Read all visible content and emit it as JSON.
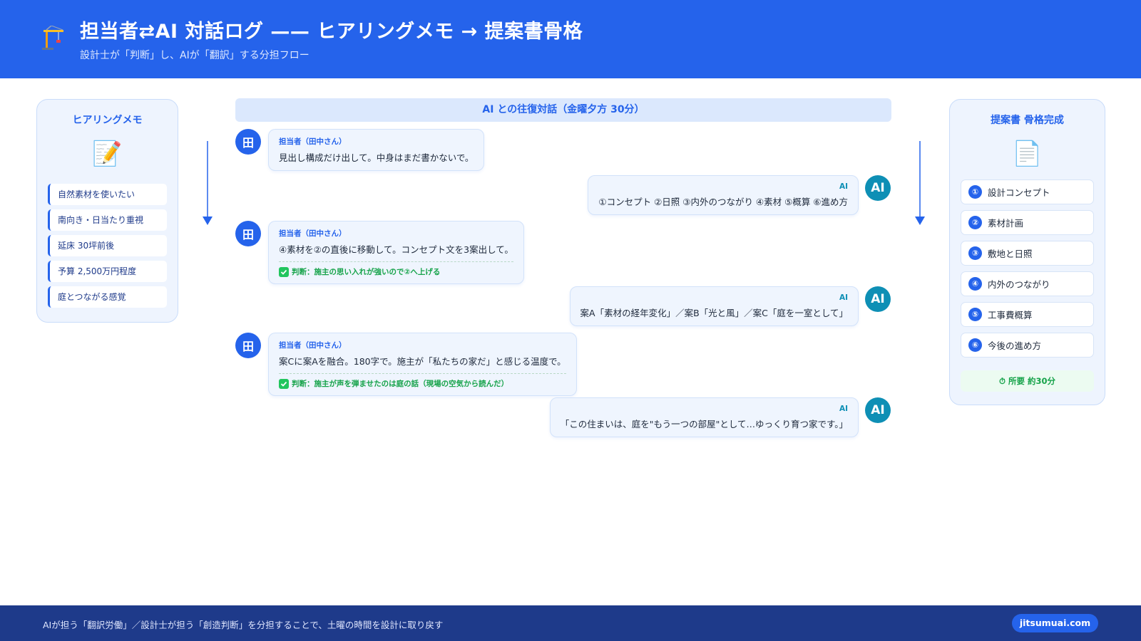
{
  "header": {
    "title": "担当者⇄AI 対話ログ —— ヒアリングメモ → 提案書骨格",
    "subtitle": "設計士が「判断」し、AIが「翻訳」する分担フロー",
    "icon": "crane-icon"
  },
  "left_panel": {
    "title": "ヒアリングメモ",
    "emoji": "📝",
    "items": [
      {
        "label": "自然素材を使いたい"
      },
      {
        "label": "南向き・日当たり重視"
      },
      {
        "label": "延床 30坪前後"
      },
      {
        "label": "予算 2,500万円程度"
      },
      {
        "label": "庭とつながる感覚"
      }
    ]
  },
  "conversation": {
    "banner": "AI との往復対話（金曜夕方 30分）",
    "messages": [
      {
        "avatar": "田",
        "speaker": "担当者（田中さん）",
        "text": "見出し構成だけ出して。中身はまだ書かないで。"
      },
      {
        "avatar": "AI",
        "speaker": "AI",
        "text": "①コンセプト ②日照 ③内外のつながり ④素材 ⑤概算 ⑥進め方"
      },
      {
        "avatar": "田",
        "speaker": "担当者（田中さん）",
        "text": "④素材を②の直後に移動して。コンセプト文を3案出して。",
        "judgement": "判断：施主の思い入れが強いので②へ上げる"
      },
      {
        "avatar": "AI",
        "speaker": "AI",
        "text": "案A「素材の経年変化」／案B「光と風」／案C「庭を一室として」"
      },
      {
        "avatar": "田",
        "speaker": "担当者（田中さん）",
        "text": "案Cに案Aを融合。180字で。施主が「私たちの家だ」と感じる温度で。",
        "judgement": "判断：施主が声を弾ませたのは庭の話（現場の空気から読んだ）"
      },
      {
        "avatar": "AI",
        "speaker": "AI",
        "text": "「この住まいは、庭を\"もう一つの部屋\"として…ゆっくり育つ家です。」"
      }
    ]
  },
  "right_panel": {
    "title": "提案書 骨格完成",
    "emoji": "📄",
    "items": [
      {
        "num": "①",
        "label": "設計コンセプト"
      },
      {
        "num": "②",
        "label": "素材計画"
      },
      {
        "num": "③",
        "label": "敷地と日照"
      },
      {
        "num": "④",
        "label": "内外のつながり"
      },
      {
        "num": "⑤",
        "label": "工事費概算"
      },
      {
        "num": "⑥",
        "label": "今後の進め方"
      }
    ],
    "time": "⏱ 所要 約30分"
  },
  "footer": {
    "text": "AIが担う「翻訳労働」／設計士が担う「創造判断」を分担することで、土曜の時間を設計に取り戻す",
    "site": "jitsumuai.com"
  }
}
